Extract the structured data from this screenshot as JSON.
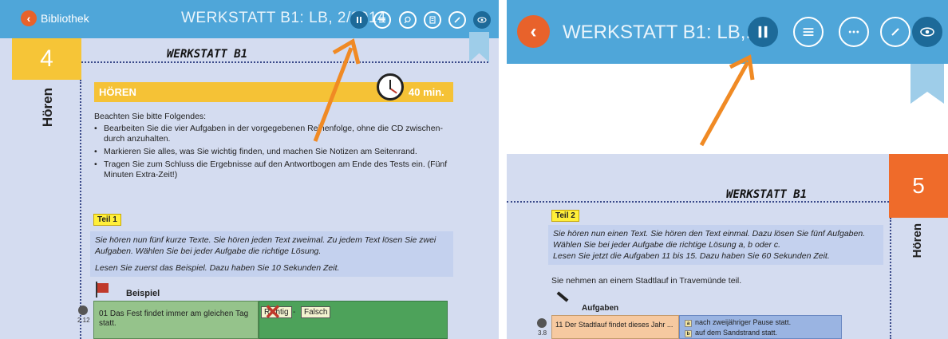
{
  "left_panel": {
    "toolbar": {
      "back_label": "Bibliothek",
      "title": "WERKSTATT B1: LB, 2/2014"
    },
    "page_number": "4",
    "section_vertical": "Hören",
    "header": "WERKSTATT B1",
    "hoeren_bar": {
      "title": "HÖREN",
      "duration": "40 min."
    },
    "intro": "Beachten Sie bitte Folgendes:",
    "bullets": [
      "Bearbeiten Sie die vier Aufgaben in der vorgegebenen Reihenfolge, ohne die CD zwischen-durch anzuhalten.",
      "Markieren Sie alles, was Sie wichtig finden, und machen Sie Notizen am Seitenrand.",
      "Tragen Sie zum Schluss die Ergebnisse auf den Antwortbogen am Ende des Tests ein. (Fünf Minuten Extra-Zeit!)"
    ],
    "teil": "Teil 1",
    "instruction_1": "Sie hören nun fünf kurze Texte. Sie hören jeden Text zweimal. Zu jedem Text lösen Sie zwei Aufgaben. Wählen Sie bei jeder Aufgabe die richtige Lösung.",
    "instruction_2": "Lesen Sie zuerst das Beispiel. Dazu haben Sie 10 Sekunden Zeit.",
    "beispiel": "Beispiel",
    "cd_track": "2.12",
    "question_01": "01 Das Fest findet immer am gleichen Tag statt.",
    "richtig": "Richtig",
    "falsch": "Falsch"
  },
  "right_panel": {
    "toolbar": {
      "title": "WERKSTATT B1: LB,..."
    },
    "page_number": "5",
    "section_vertical": "Hören",
    "header": "WERKSTATT B1",
    "teil": "Teil 2",
    "instruction_1": "Sie hören nun einen Text. Sie hören den Text einmal. Dazu lösen Sie fünf Aufgaben. Wählen Sie bei jeder Aufgabe die richtige Lösung a, b oder c.",
    "instruction_2": "Lesen Sie jetzt die Aufgaben 11 bis 15. Dazu haben Sie 60 Sekunden Zeit.",
    "context": "Sie nehmen an einem Stadtlauf in Travemünde teil.",
    "aufgaben": "Aufgaben",
    "cd_track": "3.8",
    "question_11": "11 Der Stadtlauf findet dieses Jahr ...",
    "options": [
      {
        "letter": "a",
        "text": "nach zweijähriger Pause statt."
      },
      {
        "letter": "b",
        "text": "auf dem Sandstrand statt."
      }
    ]
  },
  "colors": {
    "toolbar": "#4fa6d9",
    "back_button": "#e8622b",
    "pause_button_active": "#1d6a99",
    "arrow": "#f08a24"
  },
  "icons": [
    "back-icon",
    "pause-icon",
    "menu-icon",
    "search-icon",
    "notes-icon",
    "pencil-icon",
    "eye-icon",
    "more-icon"
  ]
}
